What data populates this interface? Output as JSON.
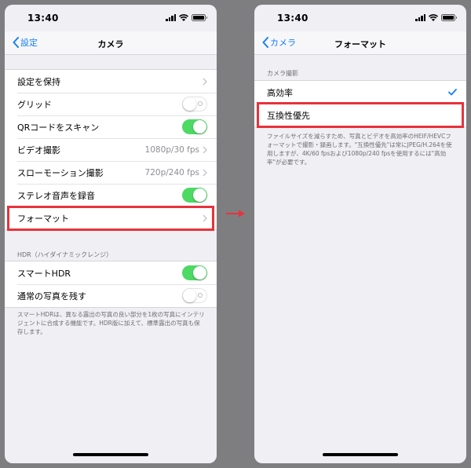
{
  "colors": {
    "accent": "#157efb",
    "toggle_on": "#4cd964",
    "highlight": "#e8323c",
    "background": "#7e7e80"
  },
  "left_screen": {
    "status_time": "13:40",
    "nav": {
      "back_label": "設定",
      "title": "カメラ"
    },
    "settings": [
      {
        "label": "設定を保持",
        "type": "chevron"
      },
      {
        "label": "グリッド",
        "type": "toggle",
        "on": false
      },
      {
        "label": "QRコードをスキャン",
        "type": "toggle",
        "on": true
      },
      {
        "label": "ビデオ撮影",
        "type": "detail",
        "value": "1080p/30 fps"
      },
      {
        "label": "スローモーション撮影",
        "type": "detail",
        "value": "720p/240 fps"
      },
      {
        "label": "ステレオ音声を録音",
        "type": "toggle",
        "on": true
      },
      {
        "label": "フォーマット",
        "type": "chevron",
        "highlighted": true
      }
    ],
    "hdr_header": "HDR（ハイダイナミックレンジ）",
    "hdr_settings": [
      {
        "label": "スマートHDR",
        "type": "toggle",
        "on": true
      },
      {
        "label": "通常の写真を残す",
        "type": "toggle",
        "on": false
      }
    ],
    "hdr_footnote": "スマートHDRは、異なる露出の写真の良い部分を1枚の写真にインテリジェントに合成する機能です。HDR版に加えて、標準露出の写真も保存します。"
  },
  "right_screen": {
    "status_time": "13:40",
    "nav": {
      "back_label": "カメラ",
      "title": "フォーマット"
    },
    "section_header": "カメラ撮影",
    "options": [
      {
        "label": "高効率",
        "selected": true
      },
      {
        "label": "互換性優先",
        "selected": false,
        "highlighted": true
      }
    ],
    "footnote": "ファイルサイズを減らすため、写真とビデオを高効率のHEIF/HEVCフォーマットで撮影・録画します。\"互換性優先\"は常にJPEG/H.264を使用しますが、4K/60 fpsおよび1080p/240 fpsを使用するには\"高効率\"が必要です。"
  },
  "icons": {
    "back": "chevron-left-icon",
    "row_arrow": "chevron-right-icon",
    "selected": "checkmark-icon",
    "transition": "right-arrow-icon"
  }
}
